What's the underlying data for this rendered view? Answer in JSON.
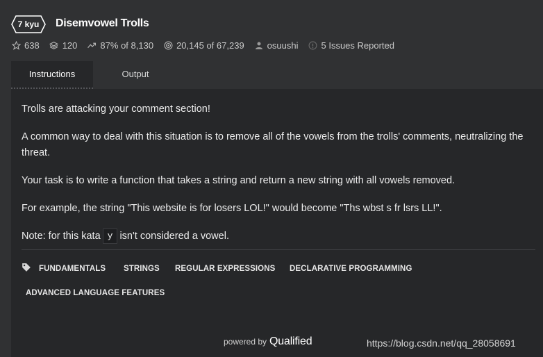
{
  "kata": {
    "rank": "7 kyu",
    "title": "Disemvowel Trolls"
  },
  "stats": {
    "stars": "638",
    "collections": "120",
    "satisfaction": "87%",
    "satisfaction_of": "of 8,130",
    "completions": "20,145",
    "completions_of": "of 67,239",
    "author": "osuushi",
    "issues": "5 Issues Reported"
  },
  "tabs": [
    {
      "label": "Instructions",
      "active": true
    },
    {
      "label": "Output",
      "active": false
    }
  ],
  "description": {
    "p1": "Trolls are attacking your comment section!",
    "p2": "A common way to deal with this situation is to remove all of the vowels from the trolls' comments, neutralizing the threat.",
    "p3": "Your task is to write a function that takes a string and return a new string with all vowels removed.",
    "p4": "For example, the string \"This website is for losers LOL!\" would become \"Ths wbst s fr lsrs LL!\".",
    "p5_before": "Note: for this kata",
    "p5_code": "y",
    "p5_after": "isn't considered a vowel."
  },
  "tags": [
    "FUNDAMENTALS",
    "STRINGS",
    "REGULAR EXPRESSIONS",
    "DECLARATIVE PROGRAMMING",
    "ADVANCED LANGUAGE FEATURES"
  ],
  "footer": {
    "powered_by": "powered by",
    "brand": "Qualified"
  },
  "watermark": "https://blog.csdn.net/qq_28058691",
  "colors": {
    "background": "#303133",
    "panel": "#262729",
    "text": "#ececec"
  }
}
